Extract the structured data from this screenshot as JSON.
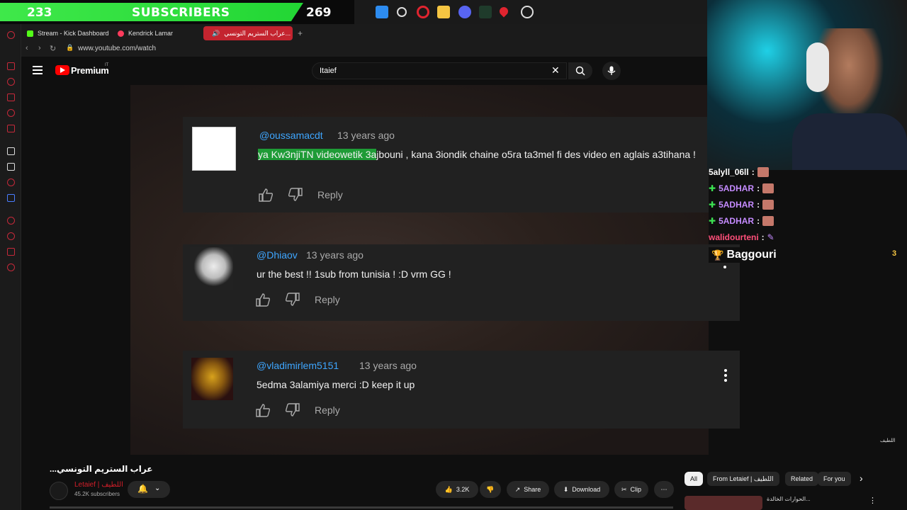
{
  "overlay": {
    "subs_current": "233",
    "subs_label": "SUBSCRIBERS",
    "subs_goal": "269"
  },
  "browser": {
    "tabs": [
      {
        "label": "Stream - Kick Dashboard",
        "color": "#53fc18"
      },
      {
        "label": "Kendrick Lamar",
        "color": "#ff3b5c"
      },
      {
        "label": "عراب الستريم التونسي...",
        "color": "#ff0000"
      }
    ],
    "url": "www.youtube.com/watch"
  },
  "youtube": {
    "brand": "Premium",
    "region": "IT",
    "search_value": "Itaief"
  },
  "comments": [
    {
      "user": "@oussamacdt",
      "time": "13 years ago",
      "text_highlight": "ya Kw3njiTN videowetik 3a",
      "text_rest": "jbouni , kana 3iondik chaine o5ra ta3mel fi des video en aglais a3tihana !",
      "reply": "Reply"
    },
    {
      "user": "@Dhiaov",
      "time": "13 years ago",
      "text": "ur the best !!  1sub from tunisia ! :D vrm GG !",
      "reply": "Reply"
    },
    {
      "user": "@vladimirlem5151",
      "time": "13 years ago",
      "text": "5edma 3alamiya merci :D keep it up",
      "reply": "Reply"
    }
  ],
  "chat": [
    {
      "user": "5alyll_06ll",
      "color": "#ffffff",
      "badge": false
    },
    {
      "user": "5ADHAR",
      "color": "#c58bff",
      "badge": true
    },
    {
      "user": "5ADHAR",
      "color": "#c58bff",
      "badge": true
    },
    {
      "user": "5ADHAR",
      "color": "#c58bff",
      "badge": true
    },
    {
      "user": "walidourteni",
      "color": "#ff4f7a",
      "badge": false
    }
  ],
  "leader": {
    "name": "Baggouri",
    "count": "3"
  },
  "video": {
    "title": "عراب الستريم التونسي...",
    "channel": "Letaief | اللطيف",
    "subscribers": "45.2K subscribers",
    "likes": "3.2K",
    "share": "Share",
    "download": "Download",
    "clip": "Clip"
  },
  "chips": [
    "All",
    "From Letaief | اللطيف",
    "Related",
    "For you"
  ],
  "related_title": "الحوارات الخالدة...",
  "stream_tag": "اللطيف"
}
